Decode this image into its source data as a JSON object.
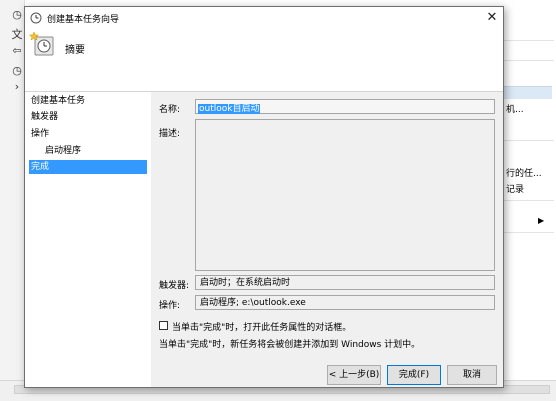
{
  "background": {
    "left_labels": [
      "文",
      "<",
      "⊙"
    ],
    "right_pane_items": [
      "机...",
      "行的任...",
      "记录"
    ]
  },
  "dialog": {
    "title": "创建基本任务向导",
    "header_title": "摘要",
    "steps": [
      {
        "label": "创建基本任务"
      },
      {
        "label": "触发器"
      },
      {
        "label": "操作"
      },
      {
        "label": "启动程序"
      },
      {
        "label": "完成"
      }
    ],
    "form": {
      "name_label": "名称:",
      "name_value": "outlook自启动",
      "desc_label": "描述:",
      "desc_value": "",
      "trigger_label": "触发器:",
      "trigger_value": "启动时；在系统启动时",
      "action_label": "操作:",
      "action_value": "启动程序; e:\\outlook.exe",
      "checkbox_label": "当单击\"完成\"时，打开此任务属性的对话框。",
      "checkbox_checked": false,
      "info_text": "当单击\"完成\"时，新任务将会被创建并添加到 Windows 计划中。"
    },
    "buttons": {
      "back": "< 上一步(B)",
      "finish": "完成(F)",
      "cancel": "取消"
    },
    "close_glyph": "✕"
  }
}
